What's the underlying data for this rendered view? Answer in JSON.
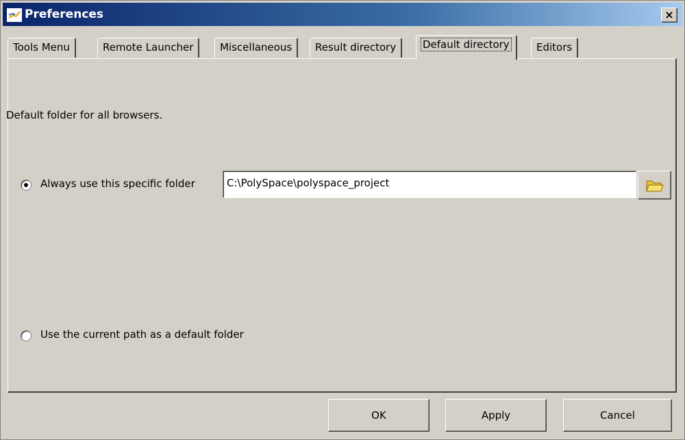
{
  "window": {
    "title": "Preferences",
    "close_label": "×"
  },
  "tabs": [
    {
      "label": "Tools Menu"
    },
    {
      "label": "Remote Launcher"
    },
    {
      "label": "Miscellaneous"
    },
    {
      "label": "Result directory"
    },
    {
      "label": "Default directory",
      "active": true
    },
    {
      "label": "Editors"
    }
  ],
  "panel": {
    "description": "Default folder for all browsers.",
    "option_specific": {
      "label": "Always use this specific folder",
      "selected": true
    },
    "folder_path": "C:\\PolySpace\\polyspace_project",
    "option_current": {
      "label": "Use the current path as a default folder",
      "selected": false
    }
  },
  "buttons": {
    "ok": "OK",
    "apply": "Apply",
    "cancel": "Cancel"
  },
  "colors": {
    "titlebar_start": "#0a246a",
    "titlebar_end": "#a6caf0",
    "face": "#d4d0c8"
  }
}
